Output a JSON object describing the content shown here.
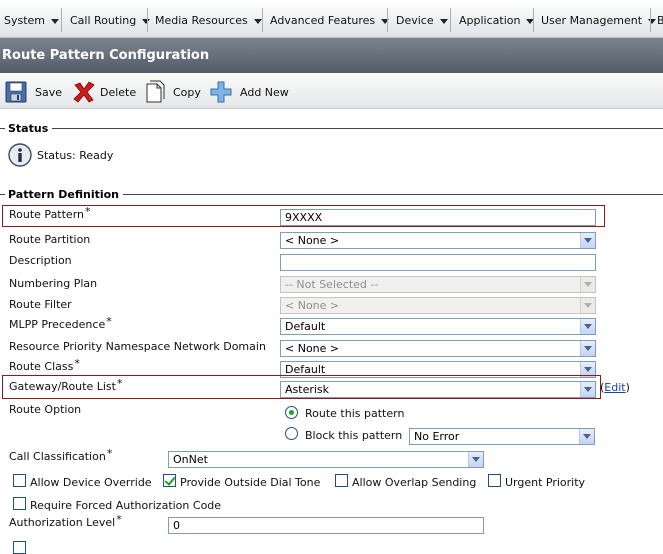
{
  "menu": {
    "items": [
      {
        "label": "System"
      },
      {
        "label": "Call Routing"
      },
      {
        "label": "Media Resources"
      },
      {
        "label": "Advanced Features"
      },
      {
        "label": "Device"
      },
      {
        "label": "Application"
      },
      {
        "label": "User Management"
      },
      {
        "label": "B"
      }
    ]
  },
  "page_title": "Route Pattern Configuration",
  "toolbar": {
    "save_label": "Save",
    "delete_label": "Delete",
    "copy_label": "Copy",
    "add_new_label": "Add New"
  },
  "status": {
    "section_title": "Status",
    "text": "Status: Ready"
  },
  "pattern_definition": {
    "section_title": "Pattern Definition",
    "route_pattern": {
      "label": "Route Pattern",
      "value": "9XXXX"
    },
    "route_partition": {
      "label": "Route Partition",
      "value": "< None >"
    },
    "description": {
      "label": "Description",
      "value": ""
    },
    "numbering_plan": {
      "label": "Numbering Plan",
      "value": "-- Not Selected --"
    },
    "route_filter": {
      "label": "Route Filter",
      "value": "< None >"
    },
    "mlpp_precedence": {
      "label": "MLPP Precedence",
      "value": "Default"
    },
    "resource_priority": {
      "label": "Resource Priority Namespace Network Domain",
      "value": "< None >"
    },
    "route_class": {
      "label": "Route Class",
      "value": "Default"
    },
    "gateway_route_list": {
      "label": "Gateway/Route List",
      "value": "Asterisk",
      "edit_link": "Edit"
    },
    "route_option": {
      "label": "Route Option",
      "route_this_pattern": "Route this pattern",
      "block_this_pattern": "Block this pattern",
      "block_reason": "No Error"
    },
    "call_classification": {
      "label": "Call Classification",
      "value": "OnNet"
    },
    "allow_device_override": "Allow Device Override",
    "provide_outside_dial_tone": "Provide Outside Dial Tone",
    "allow_overlap_sending": "Allow Overlap Sending",
    "urgent_priority": "Urgent Priority",
    "require_forced_auth": "Require Forced Authorization Code",
    "authorization_level": {
      "label": "Authorization Level",
      "value": "0"
    },
    "required_marker": "*",
    "paren_open": "(",
    "paren_close": ")"
  },
  "colors": {
    "highlight_border": "#8b1a1a",
    "title_bar": "#5f6a75",
    "link": "#1a3fb0"
  }
}
